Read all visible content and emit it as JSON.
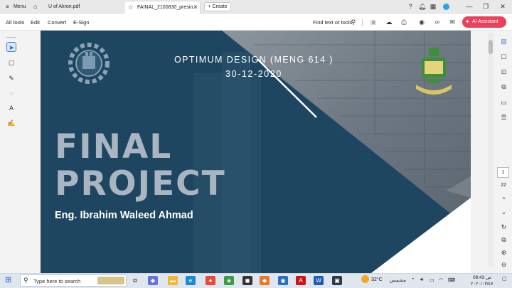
{
  "tabbar": {
    "menu_label": "Menu",
    "tab1_title": "U of Akron.pdf",
    "tab2_title": "FAINAL_2100830_presin...",
    "create_label": "Create"
  },
  "menubar": {
    "items": [
      "All tools",
      "Edit",
      "Convert",
      "E-Sign"
    ],
    "find_text": "Find text or tools",
    "ai_assistant": "AI Assistant"
  },
  "slide": {
    "course_line": "OPTIMUM DESIGN (MENG 614 )",
    "date_line": "30-12-2020",
    "title_line1": "FINAL",
    "title_line2": "PROJECT",
    "author": "Eng. Ibrahim Waleed Ahmad"
  },
  "page_nav": {
    "current": "1",
    "total": "22"
  },
  "taskbar": {
    "search_placeholder": "Type here to search",
    "weather_temp": "32°C",
    "weather_label": "مشمس",
    "time": "08:43 ص",
    "date": "٢٠٢٠/٠٣/٤٧"
  },
  "colors": {
    "slide_blue": "#1f4660",
    "title_gray": "#a9b6c1",
    "ai_red": "#e8425c",
    "select_blue": "#3d7ae8"
  }
}
